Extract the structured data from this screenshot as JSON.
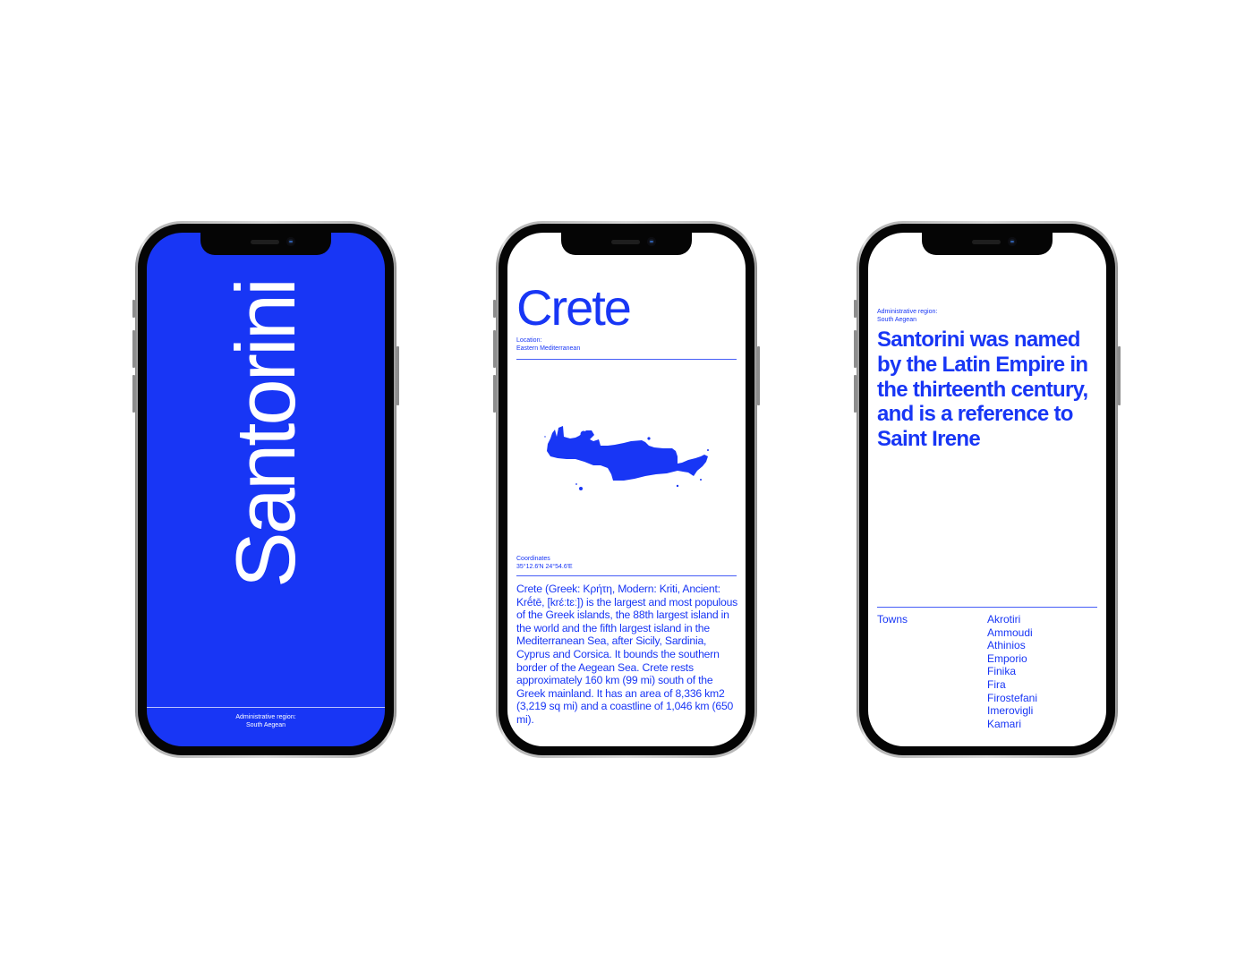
{
  "colors": {
    "accent_blue": "#1836f5",
    "background": "#ffffff",
    "phone_bezel": "#050505"
  },
  "phones": [
    {
      "title": "Santorini",
      "footer": {
        "label": "Administrative region:",
        "value": "South Aegean"
      }
    },
    {
      "title": "Crete",
      "location": {
        "label": "Location:",
        "value": "Eastern Mediterranean"
      },
      "map_icon": "crete-island-silhouette",
      "coordinates": {
        "label": "Coordinates",
        "value": "35°12.6′N 24°54.6′E"
      },
      "description": "Crete (Greek: Κρήτη, Modern: Kriti, Ancient: Krḗtē, [krɛ́ːtɛː]) is the largest and most populous of the Greek islands, the 88th largest island in the world and the fifth largest island in the Mediterranean Sea, after Sicily, Sardinia, Cyprus and Corsica. It bounds the southern border of the Aegean Sea. Crete rests approximately 160 km (99 mi) south of the Greek mainland. It has an area of 8,336 km2 (3,219 sq mi) and a coastline of 1,046 km (650 mi)."
    },
    {
      "admin": {
        "label": "Administrative region:",
        "value": "South Aegean"
      },
      "quote": "Santorini was named by the Latin Empire in the thirteenth century, and is a reference to Saint Irene",
      "towns_label": "Towns",
      "towns": [
        "Akrotiri",
        "Ammoudi",
        "Athinios",
        "Emporio",
        "Finika",
        "Fira",
        "Firostefani",
        "Imerovigli",
        "Kamari"
      ]
    }
  ]
}
